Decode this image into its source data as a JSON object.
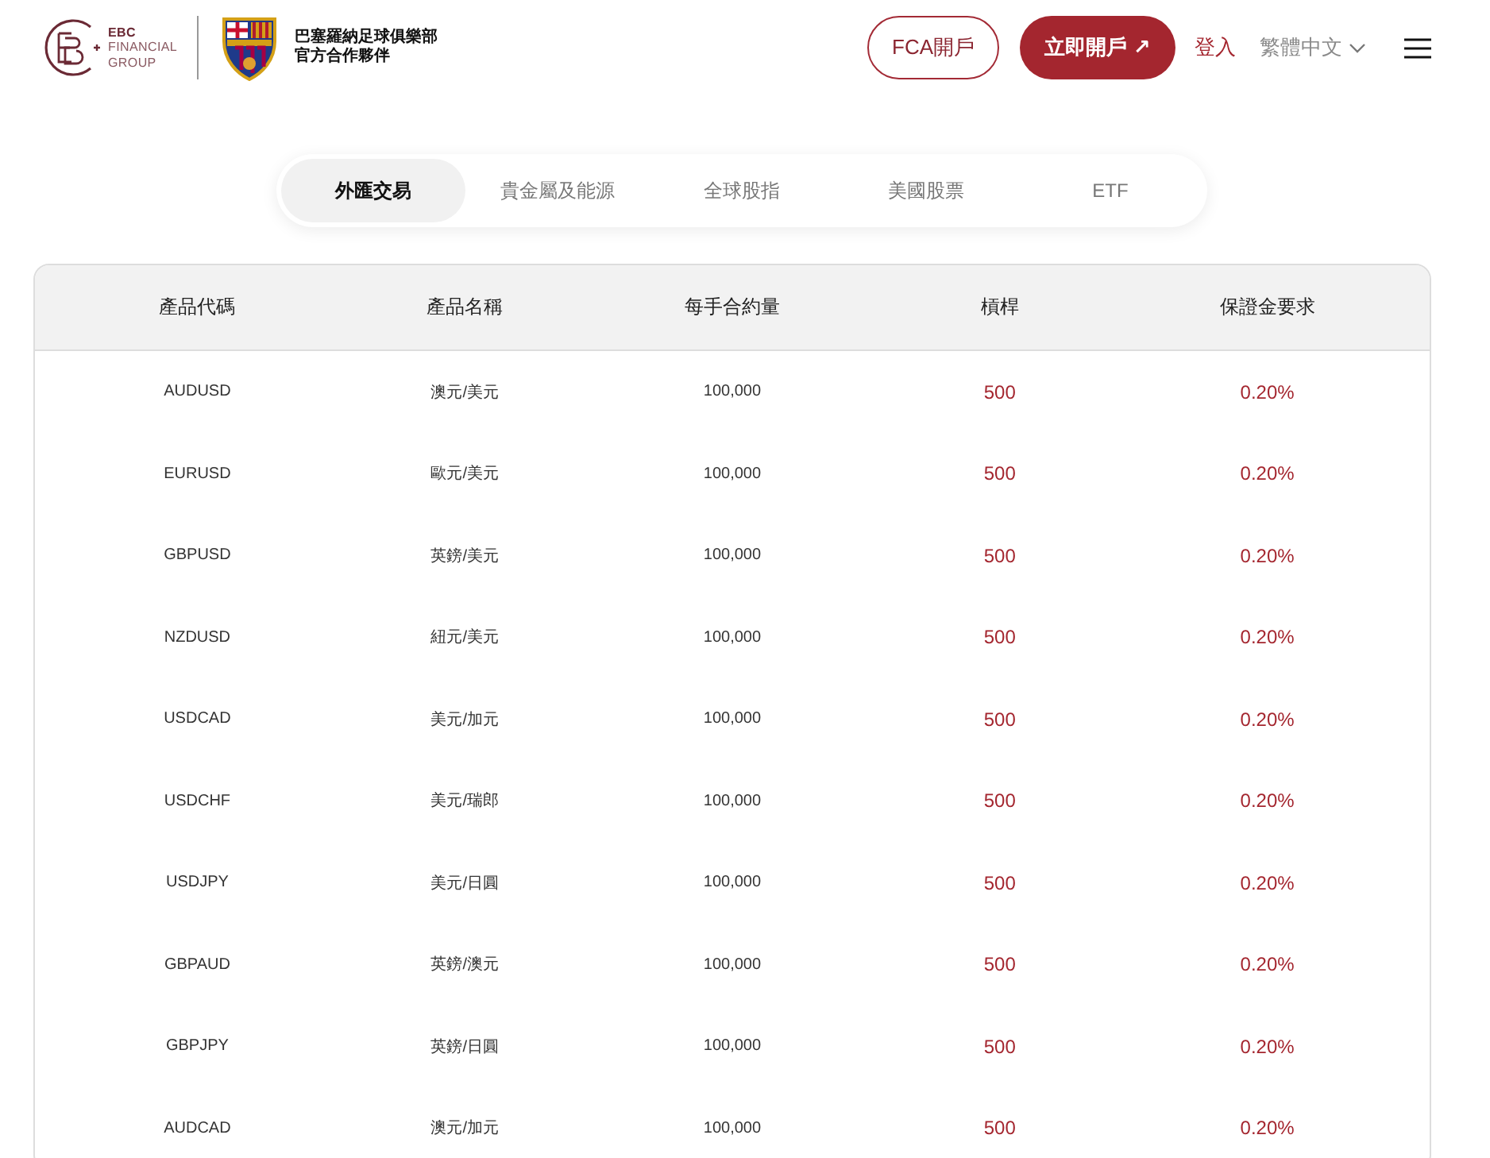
{
  "header": {
    "brand_lines": [
      "EBC",
      "FINANCIAL",
      "GROUP"
    ],
    "partner_lines": [
      "巴塞羅納足球俱樂部",
      "官方合作夥伴"
    ],
    "buttons": [
      {
        "label": "FCA開戶",
        "kind": "outline"
      },
      {
        "label": "立即開戶 ↗",
        "kind": "filled"
      }
    ],
    "login": "登入",
    "language": "繁體中文"
  },
  "tabs": [
    {
      "label": "外匯交易",
      "selected": true
    },
    {
      "label": "貴金屬及能源",
      "selected": false
    },
    {
      "label": "全球股指",
      "selected": false
    },
    {
      "label": "美國股票",
      "selected": false
    },
    {
      "label": "ETF",
      "selected": false
    }
  ],
  "table": {
    "columns": [
      "產品代碼",
      "產品名稱",
      "每手合約量",
      "槓桿",
      "保證金要求"
    ],
    "rows": [
      [
        "AUDUSD",
        "澳元/美元",
        "100,000",
        "500",
        "0.20%"
      ],
      [
        "EURUSD",
        "歐元/美元",
        "100,000",
        "500",
        "0.20%"
      ],
      [
        "GBPUSD",
        "英鎊/美元",
        "100,000",
        "500",
        "0.20%"
      ],
      [
        "NZDUSD",
        "紐元/美元",
        "100,000",
        "500",
        "0.20%"
      ],
      [
        "USDCAD",
        "美元/加元",
        "100,000",
        "500",
        "0.20%"
      ],
      [
        "USDCHF",
        "美元/瑞郎",
        "100,000",
        "500",
        "0.20%"
      ],
      [
        "USDJPY",
        "美元/日圓",
        "100,000",
        "500",
        "0.20%"
      ],
      [
        "GBPAUD",
        "英鎊/澳元",
        "100,000",
        "500",
        "0.20%"
      ],
      [
        "GBPJPY",
        "英鎊/日圓",
        "100,000",
        "500",
        "0.20%"
      ],
      [
        "AUDCAD",
        "澳元/加元",
        "100,000",
        "500",
        "0.20%"
      ]
    ]
  }
}
